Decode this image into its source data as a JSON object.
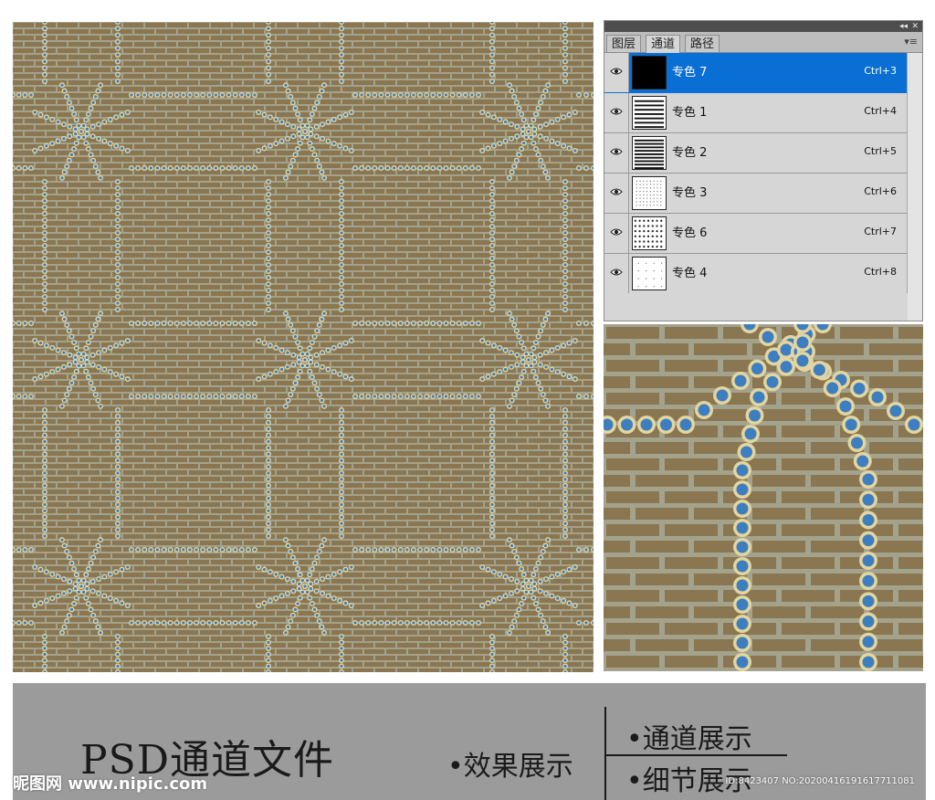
{
  "channels_panel": {
    "tabs": [
      {
        "label": "图层",
        "active": false
      },
      {
        "label": "通道",
        "active": true
      },
      {
        "label": "路径",
        "active": false
      }
    ],
    "collapse_icon": "double-chevron-icon",
    "close_icon": "close-icon",
    "menu_icon": "panel-menu-icon",
    "channels": [
      {
        "name": "专色 7",
        "shortcut": "Ctrl+3",
        "thumb": "solid",
        "selected": true
      },
      {
        "name": "专色 1",
        "shortcut": "Ctrl+4",
        "thumb": "hlines",
        "selected": false
      },
      {
        "name": "专色 2",
        "shortcut": "Ctrl+5",
        "thumb": "hlines2",
        "selected": false
      },
      {
        "name": "专色 3",
        "shortcut": "Ctrl+6",
        "thumb": "dots",
        "selected": false
      },
      {
        "name": "专色 6",
        "shortcut": "Ctrl+7",
        "thumb": "pattern",
        "selected": false
      },
      {
        "name": "专色 4",
        "shortcut": "Ctrl+8",
        "thumb": "sparse",
        "selected": false
      }
    ]
  },
  "colors": {
    "brick": "#8a7650",
    "mortar": "#a3a28c",
    "bead_ring": "#e3d5a0",
    "bead_dot": "#3d7ec0",
    "selection": "#0a6fd4"
  },
  "banner": {
    "title": "PSD通道文件",
    "effect_label": "•效果展示",
    "channel_label": "•通道展示",
    "detail_label": "•细节展示"
  },
  "watermark": {
    "logo": "昵图网 www.nipic.com",
    "id_text": "ID:8423407 NO:20200416191617711081"
  }
}
